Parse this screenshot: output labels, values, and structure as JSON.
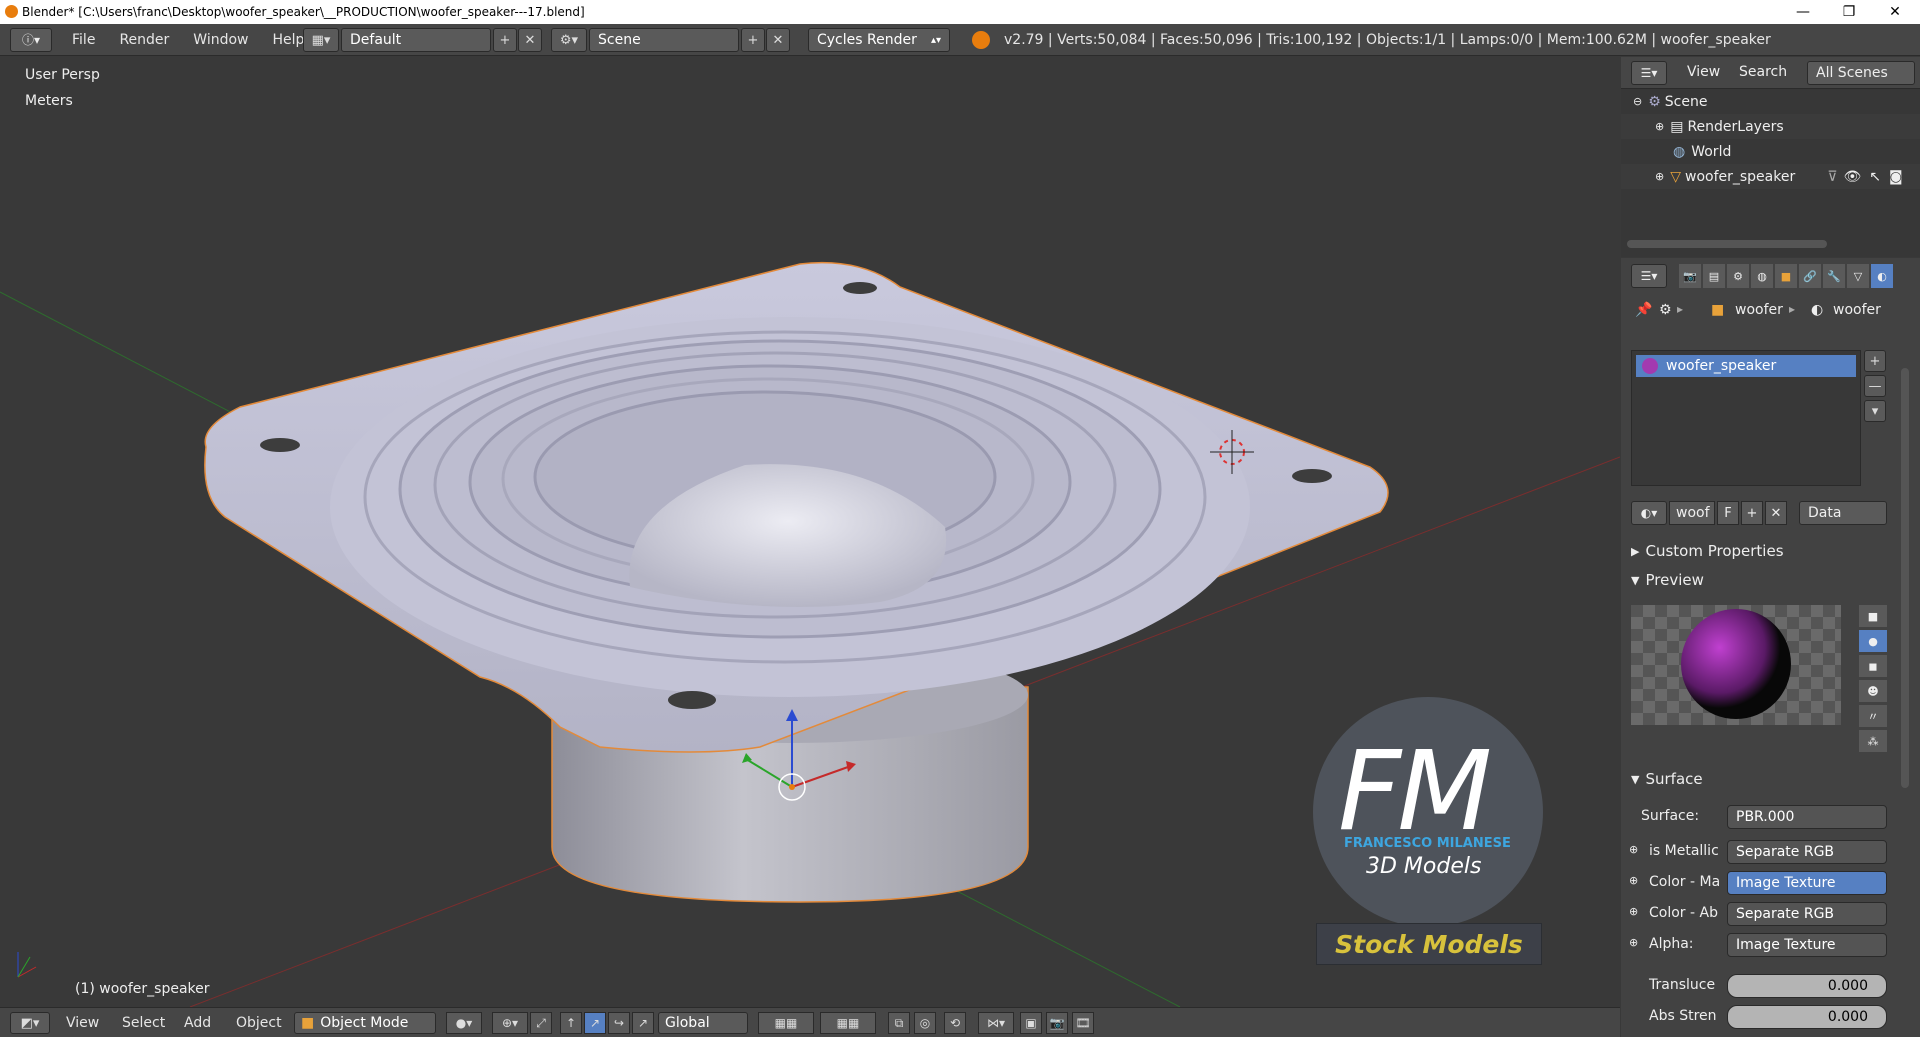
{
  "window": {
    "title": "Blender* [C:\\Users\\franc\\Desktop\\woofer_speaker\\__PRODUCTION\\woofer_speaker---17.blend]",
    "minimize": "—",
    "maximize": "❐",
    "close": "✕"
  },
  "menubar": {
    "items": [
      "File",
      "Render",
      "Window",
      "Help"
    ],
    "layout": "Default",
    "scene": "Scene",
    "engine": "Cycles Render"
  },
  "stats": "v2.79 | Verts:50,084 | Faces:50,096 | Tris:100,192 | Objects:1/1 | Lamps:0/0 | Mem:100.62M | woofer_speaker",
  "viewport": {
    "view_name": "User Persp",
    "units": "Meters",
    "object_info": "(1) woofer_speaker"
  },
  "watermark": {
    "logo": "FM",
    "author": "FRANCESCO MILANESE",
    "tagline": "3D Models",
    "banner": "Stock Models"
  },
  "bottombar": {
    "view": "View",
    "select": "Select",
    "add": "Add",
    "object": "Object",
    "mode": "Object Mode",
    "orientation": "Global"
  },
  "outliner": {
    "view": "View",
    "search": "Search",
    "filter": "All Scenes",
    "items": [
      "Scene",
      "RenderLayers",
      "World",
      "woofer_speaker"
    ]
  },
  "properties": {
    "breadcrumb": [
      "woofer",
      "woofer"
    ],
    "material_slot": "woofer_speaker",
    "material_name": "woof",
    "fake_user": "F",
    "link": "Data",
    "panels": {
      "custom": "Custom Properties",
      "preview": "Preview",
      "surface": "Surface"
    },
    "surface": {
      "label": "Surface:",
      "value": "PBR.000",
      "rows": [
        {
          "label": "is Metallic",
          "value": "Separate RGB",
          "highlight": false
        },
        {
          "label": "Color - Ma",
          "value": "Image Texture",
          "highlight": true
        },
        {
          "label": "Color - Ab",
          "value": "Separate RGB",
          "highlight": false
        },
        {
          "label": "Alpha:",
          "value": "Image Texture",
          "highlight": false
        }
      ],
      "translucent_label": "Transluce",
      "translucent_value": "0.000",
      "abs_label": "Abs Stren",
      "abs_value": "0.000"
    }
  },
  "colors": {
    "header": "#464646",
    "viewport": "#393939",
    "selected": "#5680c2",
    "accent": "#e87d0d"
  }
}
